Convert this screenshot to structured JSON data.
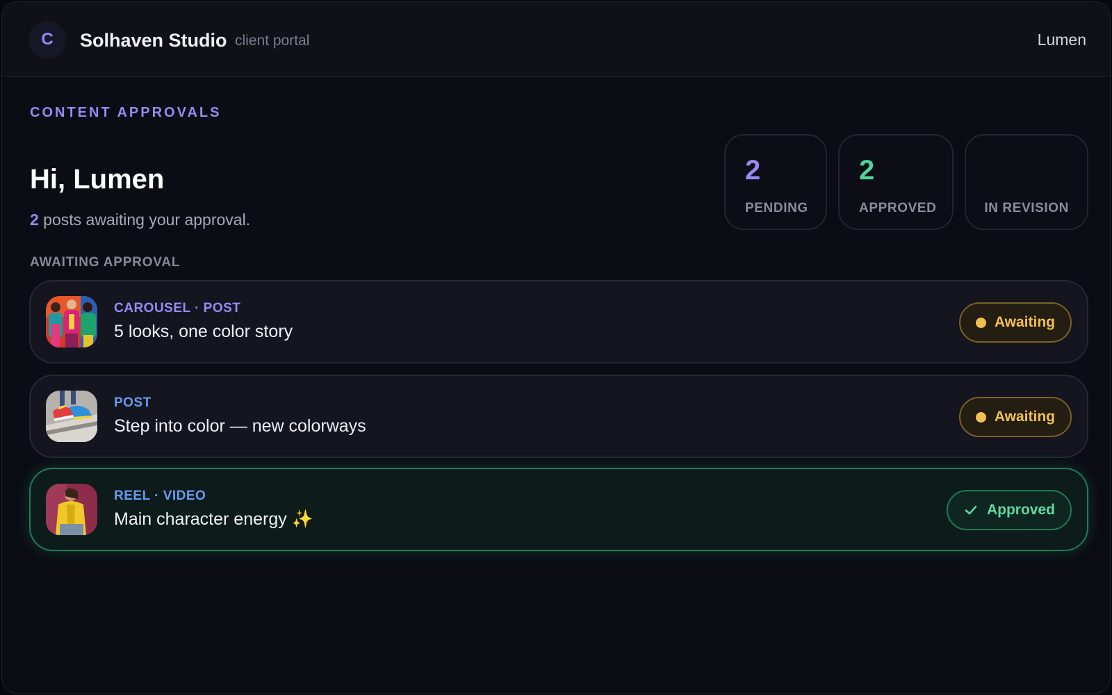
{
  "app": {
    "avatar_letter": "C",
    "studio_name": "Solhaven Studio",
    "portal_label": "client portal",
    "user_name": "Lumen"
  },
  "page": {
    "eyebrow": "CONTENT APPROVALS",
    "greeting": "Hi, Lumen",
    "summary_count": "2",
    "summary_text": " posts awaiting your approval.",
    "section_label": "AWAITING APPROVAL"
  },
  "stats": {
    "pending": {
      "value": "2",
      "label": "PENDING"
    },
    "approved": {
      "value": "2",
      "label": "APPROVED"
    },
    "revision": {
      "value": "",
      "label": "IN REVISION"
    }
  },
  "posts": [
    {
      "kind": "CAROUSEL · POST",
      "title": "5 looks, one color story",
      "status": "Awaiting",
      "thumb_icon": "fashion-group-photo"
    },
    {
      "kind": "POST",
      "title": "Step into color — new colorways",
      "status": "Awaiting",
      "thumb_icon": "sneakers-photo"
    },
    {
      "kind": "REEL · VIDEO",
      "title": "Main character energy ✨",
      "status": "Approved",
      "thumb_icon": "yellow-jacket-photo"
    }
  ],
  "colors": {
    "accent": "#9b88f5",
    "approved": "#4fd69d",
    "awaiting": "#f2c04f",
    "background": "#0b0c14"
  }
}
